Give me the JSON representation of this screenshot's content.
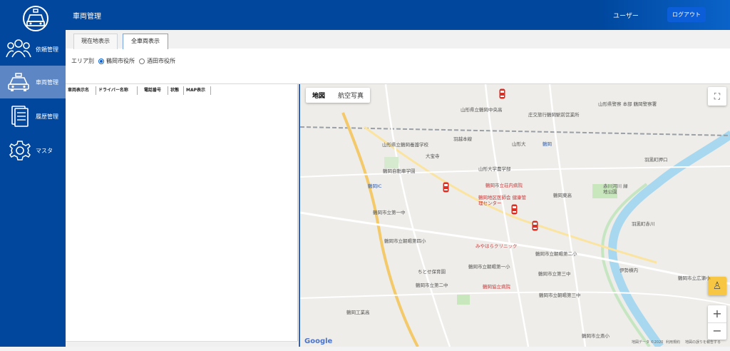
{
  "sidebar": {
    "items": [
      {
        "label": "依頼管理",
        "icon": "users-icon"
      },
      {
        "label": "車両管理",
        "icon": "car-icon"
      },
      {
        "label": "履歴管理",
        "icon": "document-icon"
      },
      {
        "label": "マスタ",
        "icon": "gear-icon"
      }
    ],
    "active_index": 1
  },
  "header": {
    "title": "車両管理",
    "user": "ユーザー",
    "logout_label": "ログアウト"
  },
  "tabs": [
    {
      "label": "現在地表示",
      "active": false
    },
    {
      "label": "全車両表示",
      "active": true
    }
  ],
  "filter": {
    "label": "エリア別",
    "options": [
      {
        "label": "鶴岡市役所",
        "selected": true
      },
      {
        "label": "酒田市役所",
        "selected": false
      }
    ]
  },
  "table": {
    "columns": [
      "車両表示名",
      "ドライバー名称",
      "電話番号",
      "状態",
      "MAP表示"
    ]
  },
  "map": {
    "type_buttons": [
      "地図",
      "航空写真"
    ],
    "selected_type": "地図",
    "zoom_in": "+",
    "zoom_out": "−",
    "labels": [
      {
        "text": "山形県立鶴岡中央高",
        "cls": ""
      },
      {
        "text": "山形県警察 本部 鶴岡警察署",
        "cls": ""
      },
      {
        "text": "庄交旅行鶴岡駅前営業所",
        "cls": ""
      },
      {
        "text": "羽越本線",
        "cls": ""
      },
      {
        "text": "山形県立鶴岡養護学校",
        "cls": ""
      },
      {
        "text": "山形大",
        "cls": ""
      },
      {
        "text": "大宝寺",
        "cls": ""
      },
      {
        "text": "鶴岡自動車学園",
        "cls": ""
      },
      {
        "text": "山形大学農学部",
        "cls": ""
      },
      {
        "text": "鶴岡市立荘内病院",
        "cls": "red"
      },
      {
        "text": "鶴岡地区医師会 健康管理センター",
        "cls": "red"
      },
      {
        "text": "鶴岡東高",
        "cls": ""
      },
      {
        "text": "赤川河川 緑地公園",
        "cls": ""
      },
      {
        "text": "鶴岡市立第一中",
        "cls": ""
      },
      {
        "text": "鶴岡市立朝暘第四小",
        "cls": ""
      },
      {
        "text": "みやはらクリニック",
        "cls": "red"
      },
      {
        "text": "鶴岡市立朝暘第二小",
        "cls": ""
      },
      {
        "text": "鶴岡市立朝暘第一小",
        "cls": ""
      },
      {
        "text": "ちとせ保育園",
        "cls": ""
      },
      {
        "text": "鶴岡市立第三中",
        "cls": ""
      },
      {
        "text": "鶴岡市立第二中",
        "cls": ""
      },
      {
        "text": "鶴岡協立病院",
        "cls": "red"
      },
      {
        "text": "鶴岡市立朝暘第三中",
        "cls": ""
      },
      {
        "text": "鶴岡市立広瀬小",
        "cls": ""
      },
      {
        "text": "鶴岡工業高",
        "cls": ""
      },
      {
        "text": "鶴岡市立斎小",
        "cls": ""
      },
      {
        "text": "羽黒町押口",
        "cls": ""
      },
      {
        "text": "羽黒町赤川",
        "cls": ""
      },
      {
        "text": "伊勢横内",
        "cls": ""
      },
      {
        "text": "鶴岡IC",
        "cls": "blue"
      },
      {
        "text": "鶴岡",
        "cls": "blue"
      }
    ],
    "footer": [
      "地図データ ©2020",
      "利用規約",
      "地図の誤りを報告する"
    ],
    "google": "Google"
  }
}
